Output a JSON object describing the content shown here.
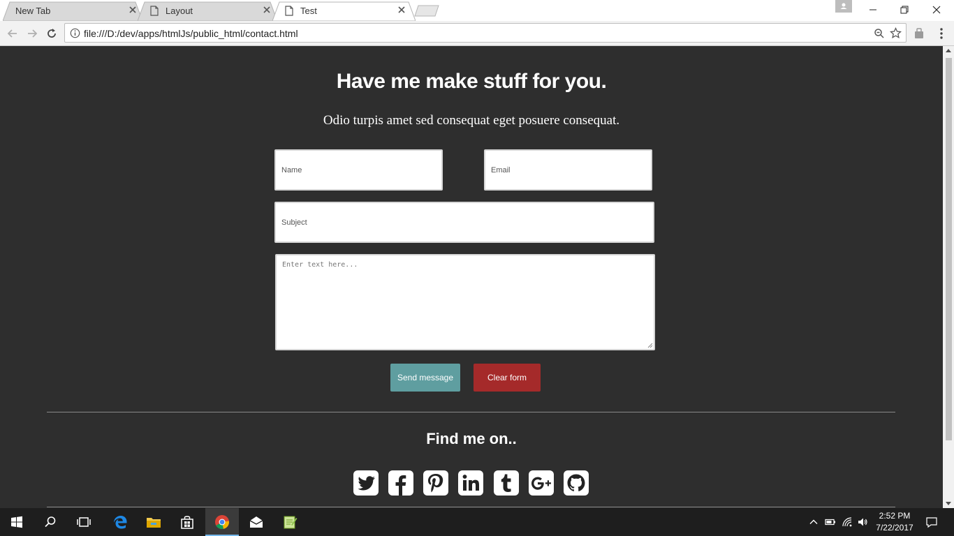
{
  "browser": {
    "tabs": [
      {
        "label": "New Tab",
        "active": false,
        "icon": "none"
      },
      {
        "label": "Layout",
        "active": false,
        "icon": "page-icon"
      },
      {
        "label": "Test",
        "active": true,
        "icon": "page-icon"
      }
    ],
    "url": "file:///D:/dev/apps/htmlJs/public_html/contact.html"
  },
  "page": {
    "heading": "Have me make stuff for you.",
    "subheading": "Odio turpis amet sed consequat eget posuere consequat.",
    "form": {
      "name_placeholder": "Name",
      "email_placeholder": "Email",
      "subject_placeholder": "Subject",
      "message_placeholder": "Enter text here...",
      "send_label": "Send message",
      "clear_label": "Clear form"
    },
    "find_heading": "Find me on..",
    "social": [
      "twitter-icon",
      "facebook-icon",
      "pinterest-icon",
      "linkedin-icon",
      "tumblr-icon",
      "google-plus-icon",
      "github-icon"
    ]
  },
  "taskbar": {
    "apps": [
      "windows-start-icon",
      "search-icon",
      "task-view-icon",
      "edge-icon",
      "file-explorer-icon",
      "store-icon",
      "chrome-icon",
      "mail-icon",
      "notepad-plus-plus-icon"
    ],
    "active_app": "chrome-icon",
    "time": "2:52 PM",
    "date": "7/22/2017"
  },
  "colors": {
    "page_background": "#2e2e2e",
    "send_button": "#5f9ea0",
    "clear_button": "#a52a2a",
    "active_taskbar_indicator": "#76b9ed"
  }
}
